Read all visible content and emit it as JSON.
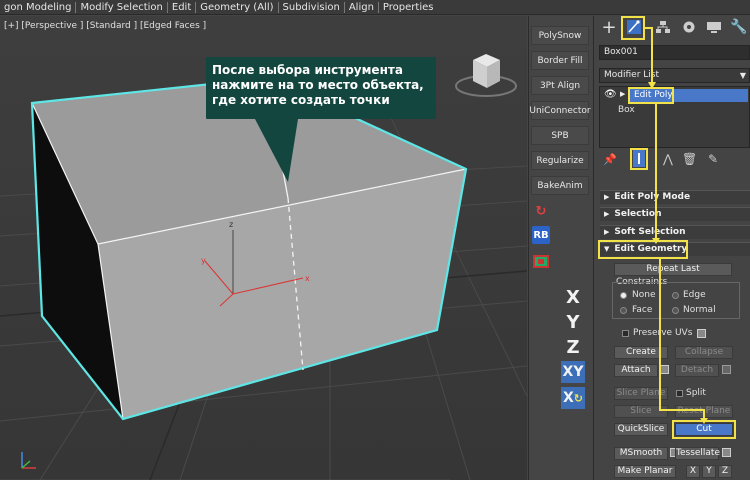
{
  "menu": {
    "items": [
      "gon Modeling",
      "Modify Selection",
      "Edit",
      "Geometry (All)",
      "Subdivision",
      "Align",
      "Properties"
    ]
  },
  "viewport": {
    "label": "[+] [Perspective ] [Standard ] [Edged Faces ]",
    "gizmo": {
      "x": "x",
      "y": "y",
      "z": "z"
    }
  },
  "callout": {
    "lines": [
      "После выбора инструмента",
      "нажмите на то место объекта,",
      "где хотите создать точки"
    ]
  },
  "scripts": {
    "buttons": [
      "PolySnow",
      "Border Fill",
      "3Pt Align",
      "UniConnector",
      "SPB",
      "Regularize",
      "BakeAnim"
    ],
    "rb_label": "RB",
    "axes": [
      "X",
      "Y",
      "Z",
      "XY",
      "X"
    ]
  },
  "panel": {
    "object_name": "Box001",
    "modifier_list": "Modifier List",
    "stack": [
      "Edit Poly",
      "Box"
    ],
    "rollouts": {
      "edit_poly_mode": "Edit Poly Mode",
      "selection": "Selection",
      "soft_selection": "Soft Selection",
      "edit_geometry": "Edit Geometry"
    },
    "repeat_last": "Repeat Last",
    "constraints_label": "Constraints",
    "constraints": [
      "None",
      "Edge",
      "Face",
      "Normal"
    ],
    "preserve_uvs": "Preserve UVs",
    "create": "Create",
    "collapse": "Collapse",
    "attach": "Attach",
    "detach": "Detach",
    "slice_plane": "Slice Plane",
    "split": "Split",
    "slice": "Slice",
    "reset_plane": "Reset Plane",
    "quickslice": "QuickSlice",
    "cut": "Cut",
    "msmooth": "MSmooth",
    "tessellate": "Tessellate",
    "make_planar": "Make Planar",
    "xyz": [
      "X",
      "Y",
      "Z"
    ]
  },
  "colors": {
    "callout_bg": "#12463f",
    "highlight": "#f2e24a",
    "selection_edge": "#5ee6e6",
    "active_stack": "#4a78c8"
  }
}
